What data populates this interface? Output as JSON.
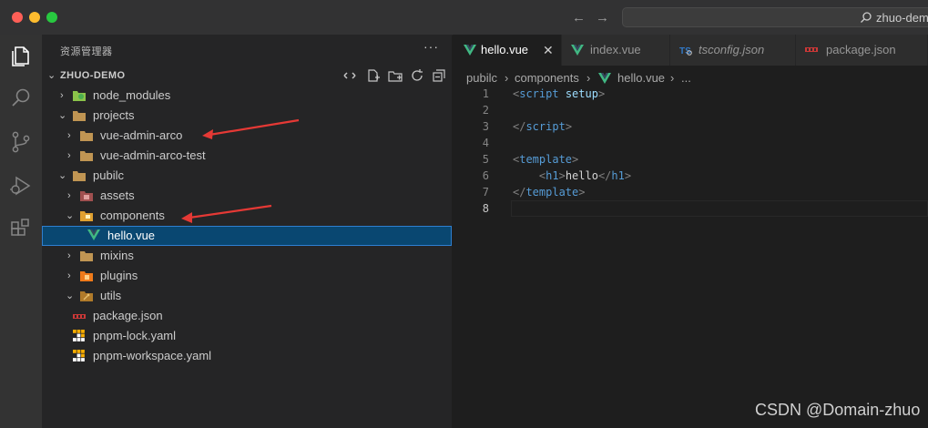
{
  "titlebar": {
    "nav_back": "←",
    "nav_forward": "→",
    "command_center_text": "zhuo-dem"
  },
  "activity_bar": {
    "items": [
      {
        "icon": "files-icon",
        "active": true
      },
      {
        "icon": "search-icon",
        "active": false
      },
      {
        "icon": "source-control-icon",
        "active": false
      },
      {
        "icon": "run-debug-icon",
        "active": false
      },
      {
        "icon": "extensions-icon",
        "active": false
      }
    ]
  },
  "sidebar": {
    "header": "资源管理器",
    "more": "···",
    "root": "ZHUO-DEMO",
    "root_actions": [
      "new-file",
      "new-folder",
      "refresh",
      "collapse"
    ],
    "tree": [
      {
        "label": "node_modules",
        "depth": 1,
        "chevron": "right",
        "icon": "node-folder"
      },
      {
        "label": "projects",
        "depth": 1,
        "chevron": "down",
        "icon": "folder"
      },
      {
        "label": "vue-admin-arco",
        "depth": 2,
        "chevron": "right",
        "icon": "folder",
        "annotated": true
      },
      {
        "label": "vue-admin-arco-test",
        "depth": 2,
        "chevron": "right",
        "icon": "folder"
      },
      {
        "label": "pubilc",
        "depth": 1,
        "chevron": "down",
        "icon": "folder"
      },
      {
        "label": "assets",
        "depth": 2,
        "chevron": "right",
        "icon": "assets-folder"
      },
      {
        "label": "components",
        "depth": 2,
        "chevron": "down",
        "icon": "components-folder",
        "annotated": true
      },
      {
        "label": "hello.vue",
        "depth": 3,
        "chevron": "",
        "icon": "vue-file",
        "selected": true
      },
      {
        "label": "mixins",
        "depth": 2,
        "chevron": "right",
        "icon": "folder"
      },
      {
        "label": "plugins",
        "depth": 2,
        "chevron": "right",
        "icon": "plugins-folder"
      },
      {
        "label": "utils",
        "depth": 2,
        "chevron": "down",
        "icon": "utils-folder"
      },
      {
        "label": "package.json",
        "depth": 1,
        "chevron": "",
        "icon": "npm-file"
      },
      {
        "label": "pnpm-lock.yaml",
        "depth": 1,
        "chevron": "",
        "icon": "pnpm-file"
      },
      {
        "label": "pnpm-workspace.yaml",
        "depth": 1,
        "chevron": "",
        "icon": "pnpm-file"
      }
    ]
  },
  "editor": {
    "tabs": [
      {
        "label": "hello.vue",
        "icon": "vue-file",
        "active": true,
        "close": "✕"
      },
      {
        "label": "index.vue",
        "icon": "vue-file",
        "active": false
      },
      {
        "label": "tsconfig.json",
        "icon": "ts-config-file",
        "active": false,
        "italic": true
      },
      {
        "label": "package.json",
        "icon": "npm-file",
        "active": false
      }
    ],
    "breadcrumbs": {
      "parts": [
        "pubilc",
        "components",
        "hello.vue",
        "..."
      ],
      "separator": "›"
    },
    "lines": [
      {
        "n": "1",
        "tokens": [
          {
            "t": "<",
            "c": "punc"
          },
          {
            "t": "script",
            "c": "tag"
          },
          {
            "t": " ",
            "c": "text"
          },
          {
            "t": "setup",
            "c": "attr"
          },
          {
            "t": ">",
            "c": "punc"
          }
        ]
      },
      {
        "n": "2",
        "tokens": []
      },
      {
        "n": "3",
        "tokens": [
          {
            "t": "</",
            "c": "punc"
          },
          {
            "t": "script",
            "c": "tag"
          },
          {
            "t": ">",
            "c": "punc"
          }
        ]
      },
      {
        "n": "4",
        "tokens": []
      },
      {
        "n": "5",
        "tokens": [
          {
            "t": "<",
            "c": "punc"
          },
          {
            "t": "template",
            "c": "tag"
          },
          {
            "t": ">",
            "c": "punc"
          }
        ]
      },
      {
        "n": "6",
        "tokens": [
          {
            "t": "    ",
            "c": "text"
          },
          {
            "t": "<",
            "c": "punc"
          },
          {
            "t": "h1",
            "c": "tag"
          },
          {
            "t": ">",
            "c": "punc"
          },
          {
            "t": "hello",
            "c": "text"
          },
          {
            "t": "</",
            "c": "punc"
          },
          {
            "t": "h1",
            "c": "tag"
          },
          {
            "t": ">",
            "c": "punc"
          }
        ]
      },
      {
        "n": "7",
        "tokens": [
          {
            "t": "</",
            "c": "punc"
          },
          {
            "t": "template",
            "c": "tag"
          },
          {
            "t": ">",
            "c": "punc"
          }
        ]
      },
      {
        "n": "8",
        "tokens": [],
        "current": true
      }
    ]
  },
  "watermark": "CSDN @Domain-zhuo",
  "colors": {
    "selection_bg": "#094771",
    "vue_green": "#41b883",
    "folder_tan": "#c09553",
    "annotation_red": "#e53935"
  }
}
